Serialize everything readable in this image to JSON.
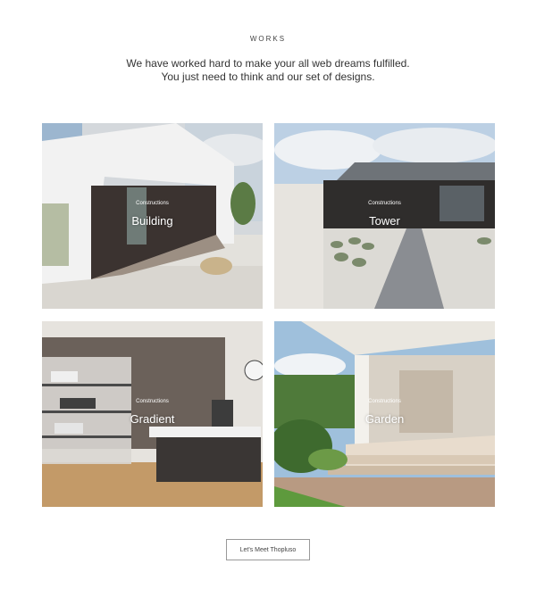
{
  "section": {
    "label": "WORKS"
  },
  "intro": {
    "line1": "We have worked hard to make your all web dreams fulfilled.",
    "line2": "You just need to think and our set of designs."
  },
  "projects": [
    {
      "category": "Constructions",
      "title": "Building"
    },
    {
      "category": "Constructions",
      "title": "Tower"
    },
    {
      "category": "Constructions",
      "title": "Gradient"
    },
    {
      "category": "Constructions",
      "title": "Garden"
    }
  ],
  "cta": {
    "label": "Let's Meet Thopluso"
  }
}
